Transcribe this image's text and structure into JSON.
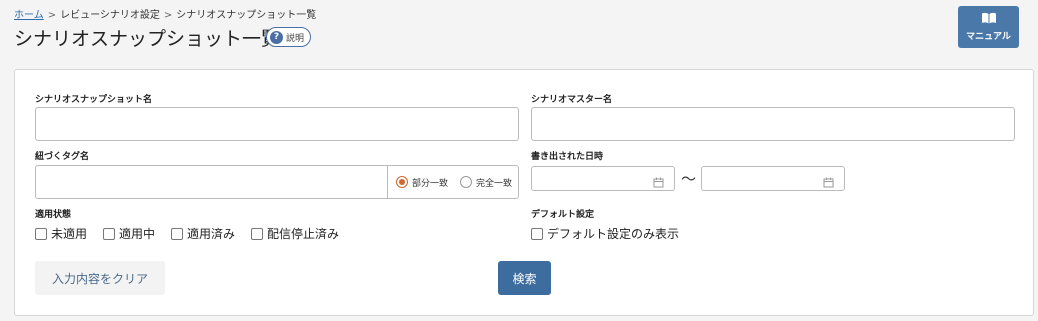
{
  "breadcrumb": {
    "home": "ホーム",
    "separator": ">",
    "level1": "レビューシナリオ設定",
    "current": "シナリオスナップショット一覧"
  },
  "page": {
    "title": "シナリオスナップショット一覧",
    "help_label": "説明",
    "help_icon": "?",
    "manual_label": "マニュアル",
    "manual_icon": "book-icon"
  },
  "form": {
    "snapshot_name": {
      "label": "シナリオスナップショット名",
      "value": "",
      "placeholder": ""
    },
    "master_name": {
      "label": "シナリオマスター名",
      "value": "",
      "placeholder": ""
    },
    "tag_name": {
      "label": "紐づくタグ名",
      "value": "",
      "match_options": [
        {
          "label": "部分一致",
          "selected": true
        },
        {
          "label": "完全一致",
          "selected": false
        }
      ]
    },
    "exported_at": {
      "label": "書き出された日時",
      "from": "",
      "to": "",
      "separator": "〜",
      "icon": "calendar-icon"
    },
    "status": {
      "label": "適用状態",
      "options": [
        {
          "label": "未適用",
          "checked": false
        },
        {
          "label": "適用中",
          "checked": false
        },
        {
          "label": "適用済み",
          "checked": false
        },
        {
          "label": "配信停止済み",
          "checked": false
        }
      ]
    },
    "default_setting": {
      "label": "デフォルト設定",
      "options": [
        {
          "label": "デフォルト設定のみ表示",
          "checked": false
        }
      ]
    },
    "clear_label": "入力内容をクリア",
    "search_label": "検索"
  },
  "colors": {
    "accent": "#3d6c9e",
    "radio_selected": "#d1662e",
    "link": "#2b6cb0"
  }
}
